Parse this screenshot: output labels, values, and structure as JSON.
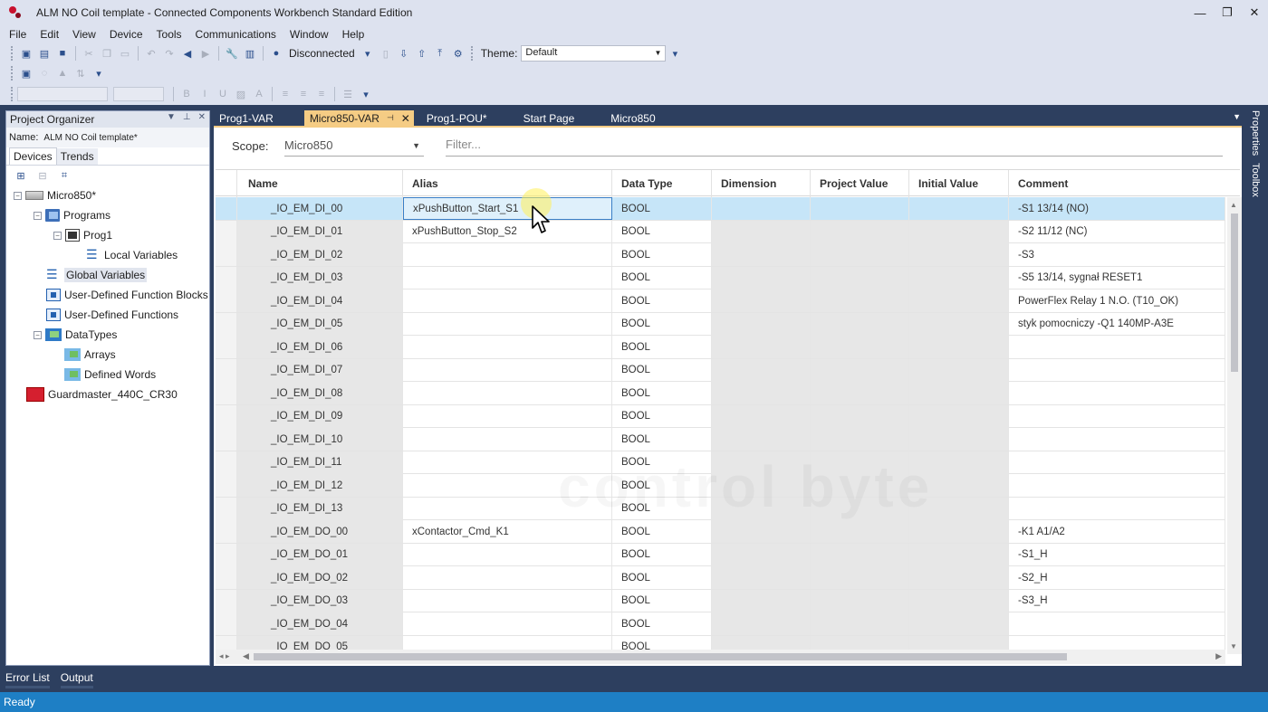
{
  "window": {
    "title": "ALM NO Coil template - Connected Components Workbench Standard Edition",
    "controls": [
      "—",
      "❐",
      "✕"
    ]
  },
  "menu": [
    "File",
    "Edit",
    "View",
    "Device",
    "Tools",
    "Communications",
    "Window",
    "Help"
  ],
  "toolbar": {
    "connection_status": "Disconnected",
    "theme_label": "Theme:",
    "theme_value": "Default"
  },
  "project_organizer": {
    "title": "Project Organizer",
    "name_label": "Name:",
    "name_value": "ALM NO Coil template*",
    "tabs": [
      "Devices",
      "Trends"
    ],
    "tree": [
      {
        "label": "Micro850*",
        "icon": "controller-icon",
        "level": 0,
        "expander": "−"
      },
      {
        "label": "Programs",
        "icon": "folder-icon",
        "level": 1,
        "expander": "−"
      },
      {
        "label": "Prog1",
        "icon": "program-icon",
        "level": 2,
        "expander": "−"
      },
      {
        "label": "Local Variables",
        "icon": "variables-icon",
        "level": 3,
        "expander": ""
      },
      {
        "label": "Global Variables",
        "icon": "variables-icon",
        "level": 1,
        "expander": "",
        "selected": true
      },
      {
        "label": "User-Defined Function Blocks",
        "icon": "function-block-icon",
        "level": 1,
        "expander": ""
      },
      {
        "label": "User-Defined Functions",
        "icon": "function-icon",
        "level": 1,
        "expander": ""
      },
      {
        "label": "DataTypes",
        "icon": "datatypes-icon",
        "level": 1,
        "expander": "−"
      },
      {
        "label": "Arrays",
        "icon": "arrays-icon",
        "level": 2,
        "expander": ""
      },
      {
        "label": "Defined Words",
        "icon": "defined-words-icon",
        "level": 2,
        "expander": ""
      },
      {
        "label": "Guardmaster_440C_CR30",
        "icon": "guardmaster-icon",
        "level": 0,
        "expander": ""
      }
    ]
  },
  "doc_tabs": [
    {
      "label": "Prog1-VAR",
      "active": false
    },
    {
      "label": "Micro850-VAR",
      "active": true
    },
    {
      "label": "Prog1-POU*",
      "active": false
    },
    {
      "label": "Start Page",
      "active": false
    },
    {
      "label": "Micro850",
      "active": false
    }
  ],
  "editor": {
    "scope_label": "Scope:",
    "scope_value": "Micro850",
    "filter_placeholder": "Filter...",
    "watermark": "control byte",
    "columns": [
      "Name",
      "Alias",
      "Data Type",
      "Dimension",
      "Project Value",
      "Initial Value",
      "Comment"
    ],
    "rows": [
      {
        "name": "_IO_EM_DI_00",
        "alias": "xPushButton_Start_S1",
        "type": "BOOL",
        "comment": "-S1 13/14 (NO)",
        "highlight": true
      },
      {
        "name": "_IO_EM_DI_01",
        "alias": "xPushButton_Stop_S2",
        "type": "BOOL",
        "comment": "-S2 11/12 (NC)"
      },
      {
        "name": "_IO_EM_DI_02",
        "alias": "",
        "type": "BOOL",
        "comment": "-S3"
      },
      {
        "name": "_IO_EM_DI_03",
        "alias": "",
        "type": "BOOL",
        "comment": "-S5 13/14, sygnał RESET1"
      },
      {
        "name": "_IO_EM_DI_04",
        "alias": "",
        "type": "BOOL",
        "comment": "PowerFlex Relay 1 N.O. (T10_OK)"
      },
      {
        "name": "_IO_EM_DI_05",
        "alias": "",
        "type": "BOOL",
        "comment": "styk pomocniczy -Q1 140MP-A3E"
      },
      {
        "name": "_IO_EM_DI_06",
        "alias": "",
        "type": "BOOL",
        "comment": ""
      },
      {
        "name": "_IO_EM_DI_07",
        "alias": "",
        "type": "BOOL",
        "comment": ""
      },
      {
        "name": "_IO_EM_DI_08",
        "alias": "",
        "type": "BOOL",
        "comment": ""
      },
      {
        "name": "_IO_EM_DI_09",
        "alias": "",
        "type": "BOOL",
        "comment": ""
      },
      {
        "name": "_IO_EM_DI_10",
        "alias": "",
        "type": "BOOL",
        "comment": ""
      },
      {
        "name": "_IO_EM_DI_11",
        "alias": "",
        "type": "BOOL",
        "comment": ""
      },
      {
        "name": "_IO_EM_DI_12",
        "alias": "",
        "type": "BOOL",
        "comment": ""
      },
      {
        "name": "_IO_EM_DI_13",
        "alias": "",
        "type": "BOOL",
        "comment": ""
      },
      {
        "name": "_IO_EM_DO_00",
        "alias": "xContactor_Cmd_K1",
        "type": "BOOL",
        "comment": "-K1 A1/A2"
      },
      {
        "name": "_IO_EM_DO_01",
        "alias": "",
        "type": "BOOL",
        "comment": "-S1_H"
      },
      {
        "name": "_IO_EM_DO_02",
        "alias": "",
        "type": "BOOL",
        "comment": "-S2_H"
      },
      {
        "name": "_IO_EM_DO_03",
        "alias": "",
        "type": "BOOL",
        "comment": "-S3_H"
      },
      {
        "name": "_IO_EM_DO_04",
        "alias": "",
        "type": "BOOL",
        "comment": ""
      },
      {
        "name": "_IO_EM_DO_05",
        "alias": "",
        "type": "BOOL",
        "comment": ""
      }
    ]
  },
  "side_tabs": [
    "Properties",
    "Toolbox"
  ],
  "bottom_tabs": [
    "Error List",
    "Output"
  ],
  "status": "Ready"
}
